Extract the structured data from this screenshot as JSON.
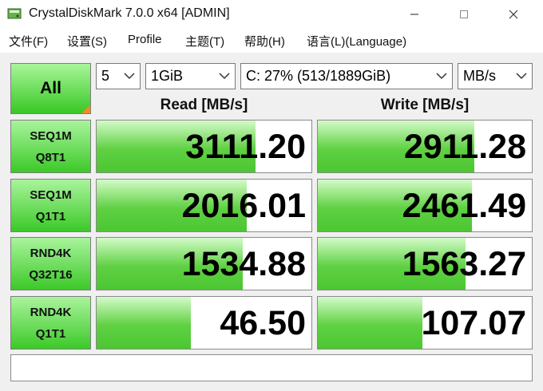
{
  "window": {
    "title": "CrystalDiskMark 7.0.0 x64 [ADMIN]",
    "app_icon": "disk-app-icon",
    "controls": {
      "minimize_icon": "minimize-icon",
      "maximize_icon": "maximize-icon",
      "close_icon": "close-icon"
    }
  },
  "menu": {
    "items": [
      "文件(F)",
      "设置(S)",
      "Profile",
      "主题(T)",
      "帮助(H)",
      "语言(L)(Language)"
    ]
  },
  "toolbar": {
    "all_label": "All",
    "test_count": "5",
    "test_size": "1GiB",
    "drive": "C: 27% (513/1889GiB)",
    "unit": "MB/s"
  },
  "columns": {
    "read": "Read [MB/s]",
    "write": "Write [MB/s]"
  },
  "rows": [
    {
      "line1": "SEQ1M",
      "line2": "Q8T1",
      "read": "3111.20",
      "write": "2911.28",
      "read_fill": 0.74,
      "write_fill": 0.73
    },
    {
      "line1": "SEQ1M",
      "line2": "Q1T1",
      "read": "2016.01",
      "write": "2461.49",
      "read_fill": 0.7,
      "write_fill": 0.72
    },
    {
      "line1": "RND4K",
      "line2": "Q32T16",
      "read": "1534.88",
      "write": "1563.27",
      "read_fill": 0.68,
      "write_fill": 0.69
    },
    {
      "line1": "RND4K",
      "line2": "Q1T1",
      "read": "46.50",
      "write": "107.07",
      "read_fill": 0.44,
      "write_fill": 0.49
    }
  ],
  "status": {
    "text": ""
  },
  "colors": {
    "accent_green": "#3cc928",
    "bar_green": "#5fd143",
    "corner_orange": "#f08a24"
  }
}
